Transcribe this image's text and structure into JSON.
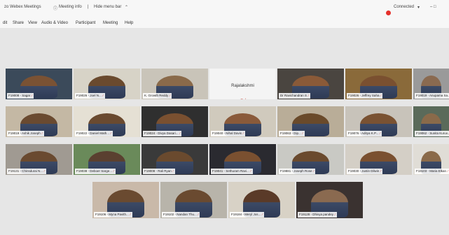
{
  "titlebar": {
    "title": "zo Webex Meetings",
    "meeting_info": "Meeting info",
    "hide_menu_bar": "Hide menu bar",
    "connected": "Connected",
    "window_controls": "–   □"
  },
  "menubar": {
    "items": [
      "dit",
      "Share",
      "View",
      "Audio & Video",
      "Participant",
      "Meeting",
      "Help"
    ]
  },
  "participants": [
    {
      "name": "F19008 - Sagar",
      "color": "#3b4a5a",
      "skin": "#7a5234"
    },
    {
      "name": "F19026 - Joel N...",
      "color": "#d7d3c7",
      "skin": "#6a4a2e"
    },
    {
      "name": "K. Growth Reddy",
      "color": "#c9c4b9",
      "skin": "#8a6a4a",
      "active": true
    },
    {
      "name": "Rajalakshmi",
      "video_off": true
    },
    {
      "name": "Dr Ravichandran S",
      "color": "#4a4540",
      "skin": "#8a5a38"
    },
    {
      "name": "F19026 - Jeffrey Saha",
      "color": "#8a6a3a",
      "skin": "#7a5030"
    },
    {
      "name": "F19019 - Anupama Sa...",
      "color": "#9a9a9a",
      "skin": "#8a6a50"
    },
    {
      "name": "F19019 - Ashik Joseph",
      "color": "#c4b8a4",
      "skin": "#6a4a30"
    },
    {
      "name": "F19022 - Daniel Math...",
      "color": "#e5e0d4",
      "skin": "#6a4a30"
    },
    {
      "name": "F19024 - Divya Dasari...",
      "color": "#2f2f2f",
      "skin": "#7a5030"
    },
    {
      "name": "F19040 - Nihal Davis",
      "color": "#d0cabd",
      "skin": "#8a5a3a"
    },
    {
      "name": "F19063 - Dip...",
      "color": "#b9ad98",
      "skin": "#6a4a2a"
    },
    {
      "name": "F19076 - Aditya K.P...",
      "color": "#c8c3ba",
      "skin": "#7a5232"
    },
    {
      "name": "F19062 - Sunita Kuruv...",
      "color": "#5a6a5a",
      "skin": "#8a6a4a"
    },
    {
      "name": "F19131 - Chinsdurai N...",
      "color": "#a09a92",
      "skin": "#6a4a30"
    },
    {
      "name": "F19038 - Deboer Sarge...",
      "color": "#6a8a5a",
      "skin": "#5a4030"
    },
    {
      "name": "F19008 - Rali Ryan",
      "color": "#3a3a3a",
      "skin": "#6a4a2e"
    },
    {
      "name": "F19041 - Sethuram Ravi...",
      "color": "#2a2a30",
      "skin": "#7a5030"
    },
    {
      "name": "F19881 - Joseph Rose",
      "color": "#c9c9c4",
      "skin": "#6a4a2e"
    },
    {
      "name": "F19030 - Justin Dilwin",
      "color": "#d4cfc6",
      "skin": "#7a5030"
    },
    {
      "name": "F19103 - Maria Elkan",
      "color": "#e0ddd6",
      "skin": "#8a6a4a"
    },
    {
      "name": "F19106 - Myna Pavith...",
      "color": "#c9b9a9",
      "skin": "#6a4a30"
    },
    {
      "name": "F19102 - Nandan Thu...",
      "color": "#b8b4aa",
      "skin": "#6a4a30"
    },
    {
      "name": "F19184 - Meryl Jos...",
      "color": "#d8d2c6",
      "skin": "#5a3a28"
    },
    {
      "name": "F19128 - Dhivya pandey",
      "color": "#3a3230",
      "skin": "#8a6a50"
    }
  ]
}
